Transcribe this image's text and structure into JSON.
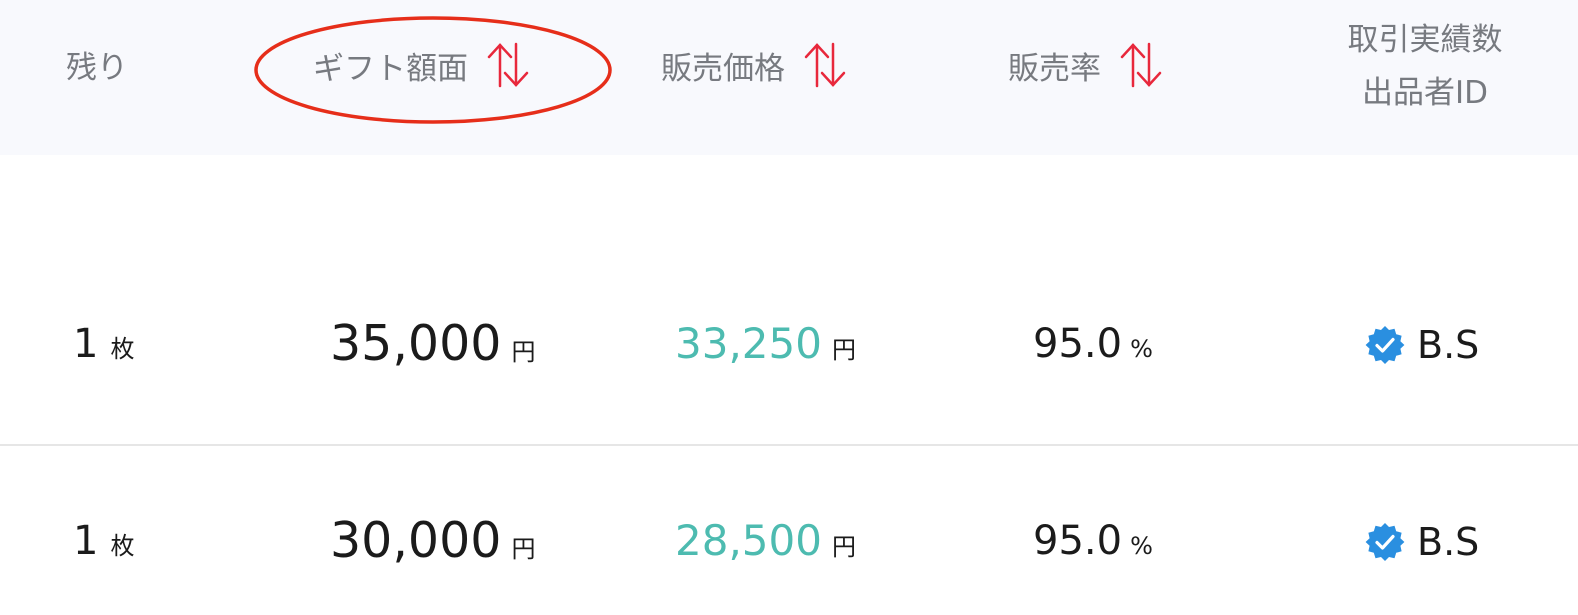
{
  "header": {
    "columns": {
      "remaining": "残り",
      "gift_value": "ギフト額面",
      "sale_price": "販売価格",
      "sale_rate": "販売率",
      "seller_line1": "取引実績数",
      "seller_line2": "出品者ID"
    },
    "highlight_color": "#e62e1a",
    "sort_icon_color": "#e8283c"
  },
  "rows": [
    {
      "remaining": "1",
      "remaining_unit": "枚",
      "gift_value": "35,000",
      "gift_unit": "円",
      "sale_price": "33,250",
      "price_unit": "円",
      "sale_rate": "95.0",
      "rate_unit": "%",
      "seller_id": "B.S"
    },
    {
      "remaining": "1",
      "remaining_unit": "枚",
      "gift_value": "30,000",
      "gift_unit": "円",
      "sale_price": "28,500",
      "price_unit": "円",
      "sale_rate": "95.0",
      "rate_unit": "%",
      "seller_id": "B.S"
    }
  ],
  "colors": {
    "header_bg": "#f8f9fd",
    "price_teal": "#4dbbb0",
    "verified_blue": "#2a8fe0"
  }
}
